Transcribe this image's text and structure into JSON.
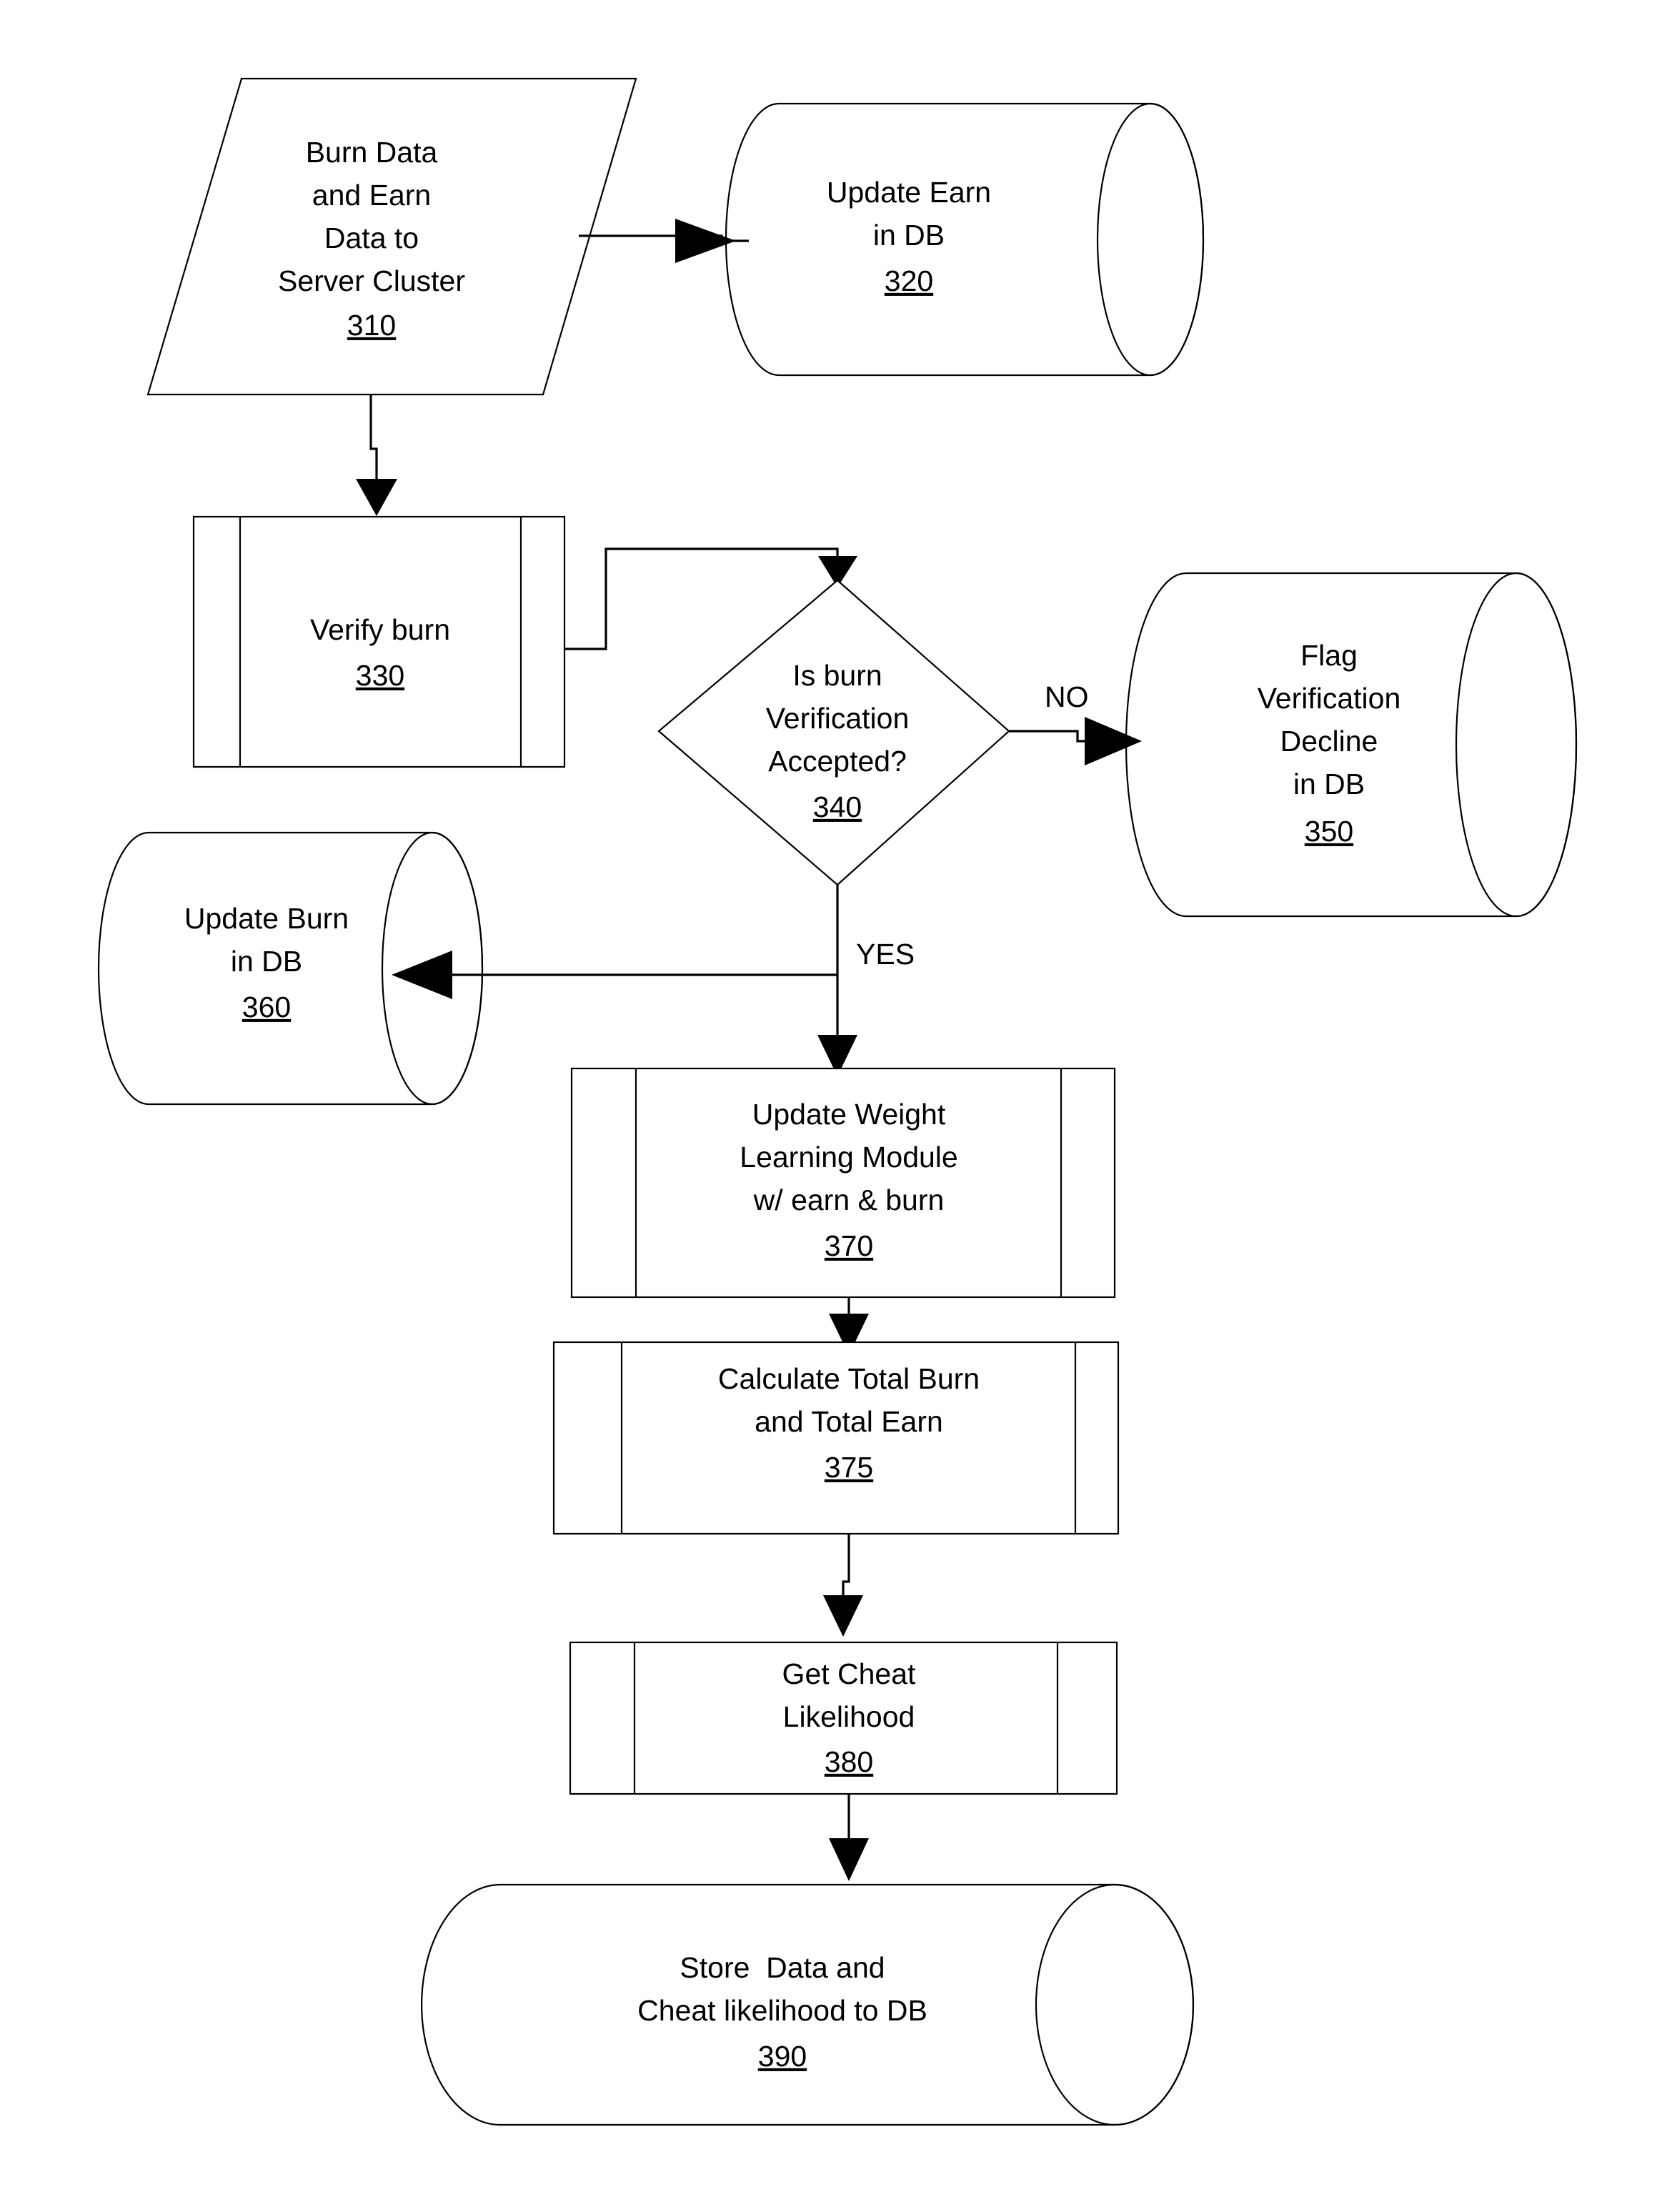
{
  "diagram": {
    "type": "flowchart",
    "title": "",
    "nodes": [
      {
        "id": "310",
        "shape": "parallelogram",
        "ref": "310",
        "lines": [
          "Burn Data",
          "and Earn",
          "Data to",
          "Server Cluster"
        ]
      },
      {
        "id": "320",
        "shape": "cylinder-horizontal",
        "ref": "320",
        "lines": [
          "Update Earn",
          "in DB"
        ]
      },
      {
        "id": "330",
        "shape": "predefined-process",
        "ref": "330",
        "lines": [
          "Verify burn"
        ]
      },
      {
        "id": "340",
        "shape": "decision-diamond",
        "ref": "340",
        "lines": [
          "Is burn",
          "Verification",
          "Accepted?"
        ]
      },
      {
        "id": "350",
        "shape": "cylinder-horizontal",
        "ref": "350",
        "lines": [
          "Flag",
          "Verification",
          "Decline",
          "in DB"
        ]
      },
      {
        "id": "360",
        "shape": "cylinder-horizontal",
        "ref": "360",
        "lines": [
          "Update Burn",
          "in DB"
        ]
      },
      {
        "id": "370",
        "shape": "predefined-process",
        "ref": "370",
        "lines": [
          "Update Weight",
          "Learning Module",
          "w/ earn & burn"
        ]
      },
      {
        "id": "375",
        "shape": "predefined-process",
        "ref": "375",
        "lines": [
          "Calculate Total Burn",
          "and Total Earn"
        ]
      },
      {
        "id": "380",
        "shape": "predefined-process",
        "ref": "380",
        "lines": [
          "Get Cheat",
          "Likelihood"
        ]
      },
      {
        "id": "390",
        "shape": "stadium-cylinder",
        "ref": "390",
        "lines": [
          "Store  Data and",
          "Cheat likelihood to DB"
        ]
      }
    ],
    "edges": [
      {
        "from": "310",
        "to": "320",
        "label": ""
      },
      {
        "from": "310",
        "to": "330",
        "label": ""
      },
      {
        "from": "330",
        "to": "340",
        "label": ""
      },
      {
        "from": "340",
        "to": "350",
        "label": "NO"
      },
      {
        "from": "340",
        "to": "360",
        "label": ""
      },
      {
        "from": "340",
        "to": "370",
        "label": "YES"
      },
      {
        "from": "370",
        "to": "375",
        "label": ""
      },
      {
        "from": "375",
        "to": "380",
        "label": ""
      },
      {
        "from": "380",
        "to": "390",
        "label": ""
      }
    ],
    "edge_labels": {
      "no": "NO",
      "yes": "YES"
    },
    "colors": {
      "stroke": "#000000",
      "fill": "#ffffff",
      "background": "#ffffff"
    }
  }
}
